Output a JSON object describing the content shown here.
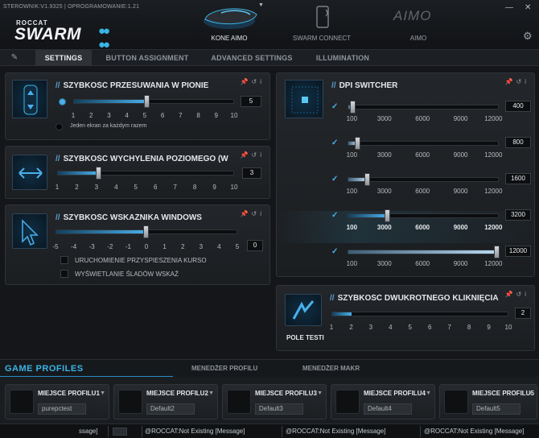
{
  "app": {
    "version_text": "STEROWNIK:V1.9325 | OPROGRAMOWANIE:1.21",
    "logo_top": "ROCCAT",
    "logo_main": "SWARM",
    "window_controls": {
      "minimize": "—",
      "close": "✕"
    }
  },
  "devices": [
    {
      "label": "KONE AIMO",
      "active": true
    },
    {
      "label": "SWARM CONNECT",
      "active": false
    },
    {
      "label": "AIMO",
      "active": false
    }
  ],
  "tabs": [
    {
      "label": "SETTINGS",
      "active": true
    },
    {
      "label": "BUTTON ASSIGNMENT",
      "active": false
    },
    {
      "label": "ADVANCED SETTINGS",
      "active": false
    },
    {
      "label": "ILLUMINATION",
      "active": false
    }
  ],
  "vertical_scroll": {
    "title": "SZYBKOŚĆ PRZESUWANIA W PIONIE",
    "ticks": [
      "1",
      "2",
      "3",
      "4",
      "5",
      "6",
      "7",
      "8",
      "9",
      "10"
    ],
    "value": "5",
    "option_label": "Jeden ekran za każdym razem"
  },
  "horizontal_tilt": {
    "title": "SZYBKOŚĆ WYCHYLENIA POZIOMEGO (W T",
    "ticks": [
      "1",
      "2",
      "3",
      "4",
      "5",
      "6",
      "7",
      "8",
      "9",
      "10"
    ],
    "value": "3"
  },
  "pointer_speed": {
    "title": "SZYBKOŚĆ WSKAŹNIKA WINDOWS",
    "ticks": [
      "-5",
      "-4",
      "-3",
      "-2",
      "-1",
      "0",
      "1",
      "2",
      "3",
      "4",
      "5"
    ],
    "value": "0",
    "options": [
      {
        "label": "URUCHOMIENIE PRZYSPIESZENIA KURSO",
        "checked": false
      },
      {
        "label": "WYŚWIETLANIE ŚLADÓW WSKAŹ",
        "checked": false
      }
    ]
  },
  "dpi": {
    "title": "DPI SWITCHER",
    "ticks": [
      "100",
      "3000",
      "6000",
      "9000",
      "12000"
    ],
    "levels": [
      {
        "value": "400",
        "fraction": 0.025,
        "checked": true,
        "active": false
      },
      {
        "value": "800",
        "fraction": 0.058,
        "checked": true,
        "active": false
      },
      {
        "value": "1600",
        "fraction": 0.124,
        "checked": true,
        "active": false
      },
      {
        "value": "3200",
        "fraction": 0.256,
        "checked": true,
        "active": true
      },
      {
        "value": "12000",
        "fraction": 1.0,
        "checked": true,
        "active": false
      }
    ]
  },
  "double_click": {
    "title": "SZYBKOŚĆ DWUKROTNEGO KLIKNIĘCIA",
    "ticks": [
      "1",
      "2",
      "3",
      "4",
      "5",
      "6",
      "7",
      "8",
      "9",
      "10"
    ],
    "value": "2",
    "test_label": "POLE TESTI"
  },
  "profiles_bar": {
    "title": "GAME PROFILES",
    "tabs": [
      "MENEDŻER PROFILU",
      "MENEDŻER MAKR"
    ]
  },
  "profiles": [
    {
      "name": "MIEJSCE PROFILU1",
      "value": "purepctest"
    },
    {
      "name": "MIEJSCE PROFILU2",
      "value": "Default2"
    },
    {
      "name": "MIEJSCE PROFILU3",
      "value": "Default3"
    },
    {
      "name": "MIEJSCE PROFILU4",
      "value": "Default4"
    },
    {
      "name": "MIEJSCE PROFILU5",
      "value": "Default5"
    }
  ],
  "status": {
    "partial": "ssage]",
    "messages": [
      "@ROCCAT:Not Existing [Message]",
      "@ROCCAT:Not Existing [Message]",
      "@ROCCAT:Not Existing [Message]"
    ]
  },
  "colors": {
    "accent": "#3ab4e6",
    "panel": "#1f2226",
    "background": "#141619"
  }
}
